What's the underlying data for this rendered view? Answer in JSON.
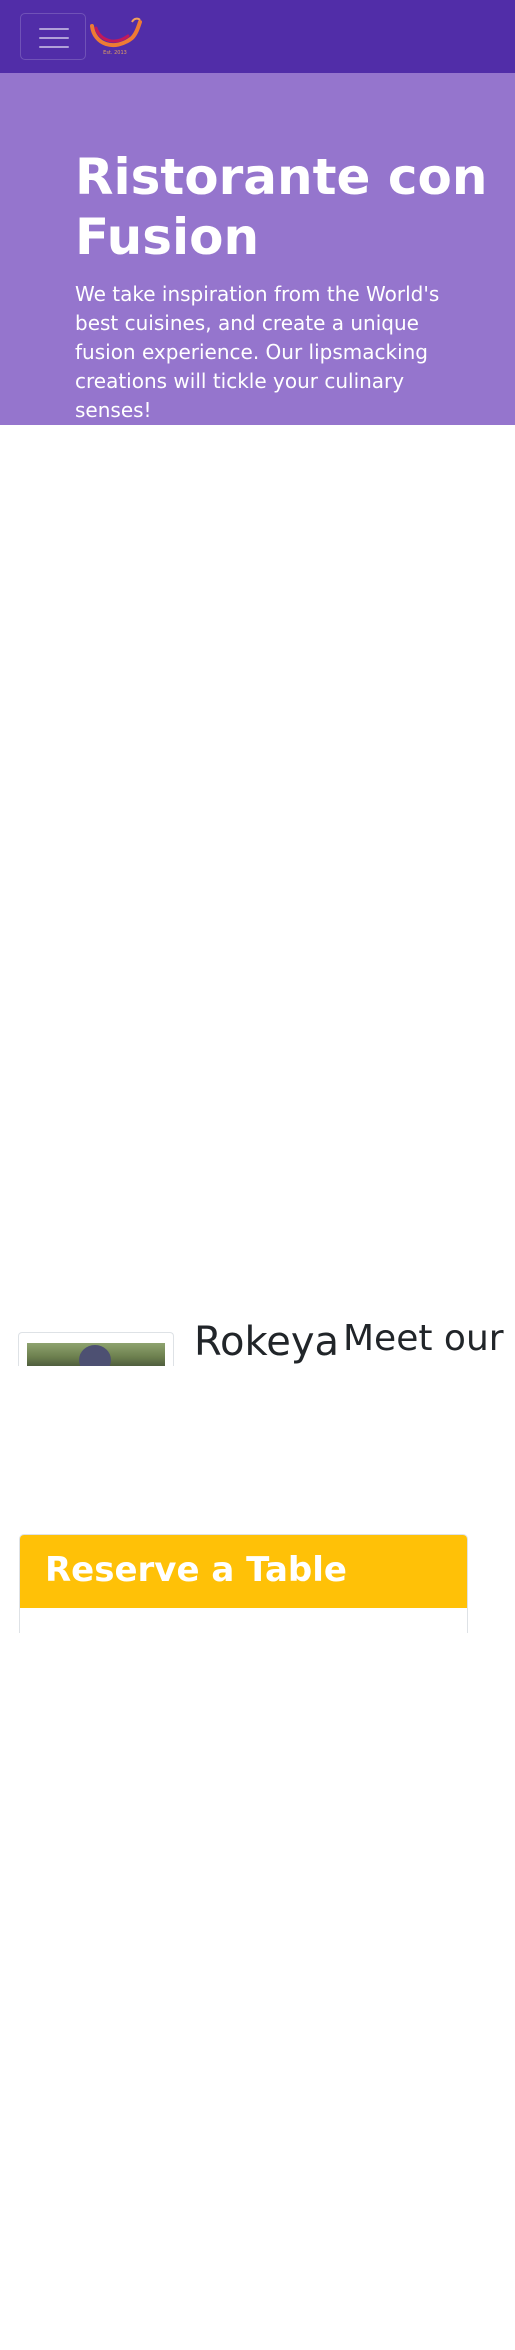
{
  "navbar": {
    "toggler_icon": "menu-icon",
    "logo_icon": "restaurant-logo-icon",
    "logo_text": "Est. 2013",
    "brand_color": "#512da8"
  },
  "hero": {
    "title": "Ristorante con Fusion",
    "text": "We take inspiration from the World's best cuisines, and create a unique fusion experience. Our lipsmacking creations will tickle your culinary senses!",
    "background_color": "#9575cd"
  },
  "leader": {
    "name": "Rokeya",
    "photo_icon": "leader-photo"
  },
  "about": {
    "heading": "Meet our Culinary Specialists"
  },
  "reserve": {
    "title": "Reserve a Table",
    "header_color": "#ffc107"
  }
}
